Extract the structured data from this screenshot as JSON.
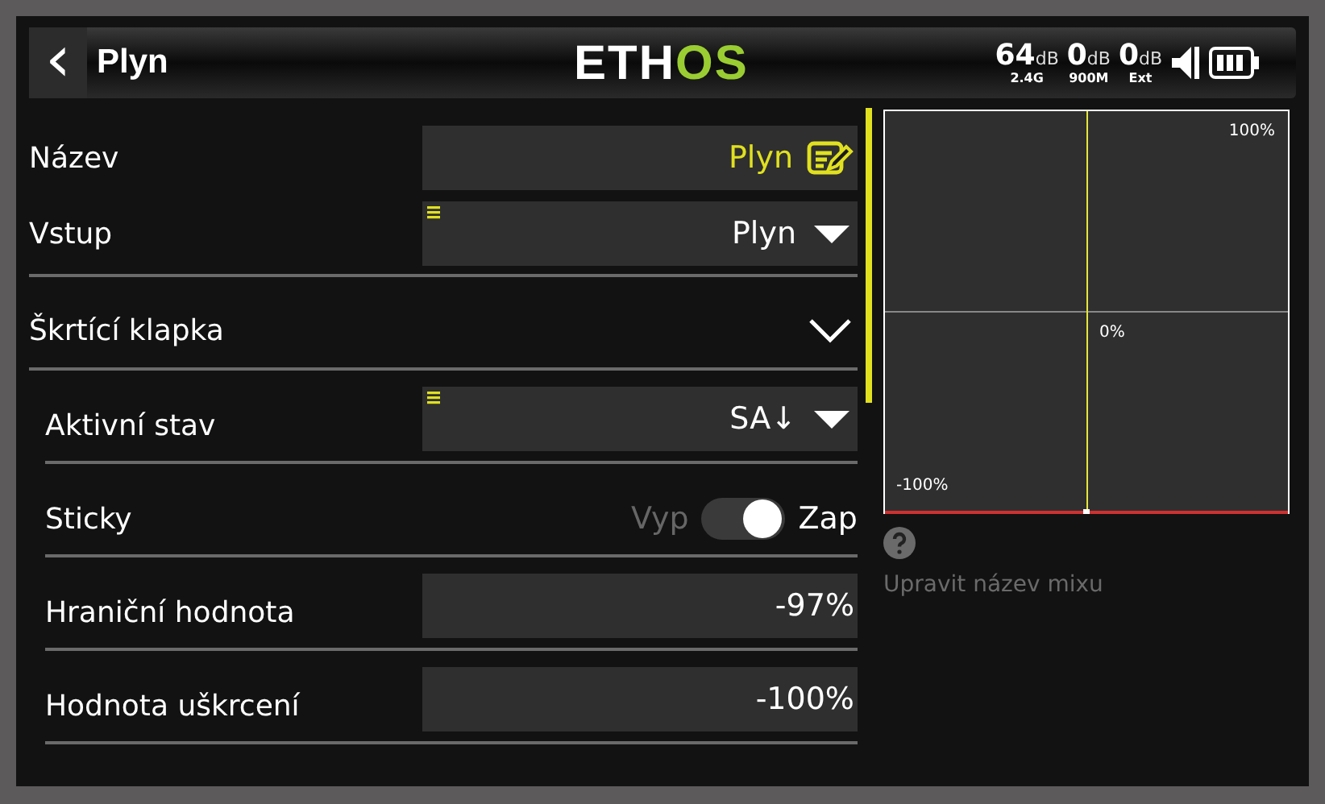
{
  "header": {
    "back": "‹",
    "title": "Plyn",
    "logo": [
      {
        "text": "ETH",
        "color": "#ffffff"
      },
      {
        "text": "OS",
        "color": "#9acd32"
      }
    ],
    "signals": [
      {
        "value": "64",
        "unit": "dB",
        "sub": "2.4G"
      },
      {
        "value": "0",
        "unit": "dB",
        "sub": "900M"
      },
      {
        "value": "0",
        "unit": "dB",
        "sub": "Ext"
      }
    ]
  },
  "rows": [
    {
      "kind": "text",
      "label": "Název",
      "value": "Plyn",
      "indent": false
    },
    {
      "kind": "dropdown",
      "label": "Vstup",
      "value": "Plyn",
      "indent": false
    },
    {
      "kind": "section",
      "label": "Škrtící klapka",
      "expanded": true,
      "indent": false
    },
    {
      "kind": "dropdown",
      "label": "Aktivní stav",
      "value": "SA↓",
      "indent": true
    },
    {
      "kind": "toggle",
      "label": "Sticky",
      "off_label": "Vyp",
      "on_label": "Zap",
      "on": true,
      "indent": true
    },
    {
      "kind": "number",
      "label": "Hraniční hodnota",
      "value": "-97%",
      "indent": true
    },
    {
      "kind": "number",
      "label": "Hodnota uškrcení",
      "value": "-100%",
      "indent": true
    }
  ],
  "graph": {
    "top_label": "100%",
    "center_label": "0%",
    "bottom_label": "-100%"
  },
  "help": {
    "text": "Upravit název mixu"
  }
}
